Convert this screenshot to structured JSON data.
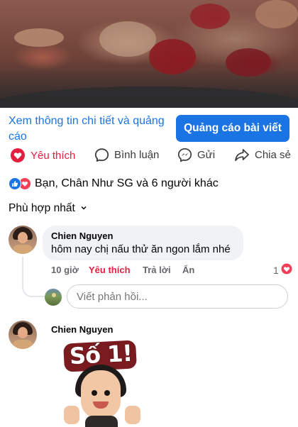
{
  "ad": {
    "info_link": "Xem thông tin chi tiết và quảng cáo",
    "boost_button": "Quảng cáo bài viết"
  },
  "actions": {
    "like": "Yêu thích",
    "comment": "Bình luận",
    "send": "Gửi",
    "share": "Chia sẻ"
  },
  "reactions": {
    "summary": "Bạn, Chân Như SG và 6 người khác"
  },
  "sort": {
    "label": "Phù hợp nhất"
  },
  "comments": [
    {
      "author": "Chien Nguyen",
      "text": "hôm nay chị nấu thử ăn ngon lắm nhé",
      "time": "10 giờ",
      "like_label": "Yêu thích",
      "reply_label": "Trả lời",
      "hide_label": "Ẩn",
      "reaction_count": "1"
    },
    {
      "author": "Chien Nguyen",
      "sticker_text": "Số 1!"
    }
  ],
  "reply_box": {
    "placeholder": "Viết phản hồi..."
  },
  "colors": {
    "accent": "#1b74e4",
    "like_red": "#e41e3f",
    "muted": "#65676b"
  }
}
